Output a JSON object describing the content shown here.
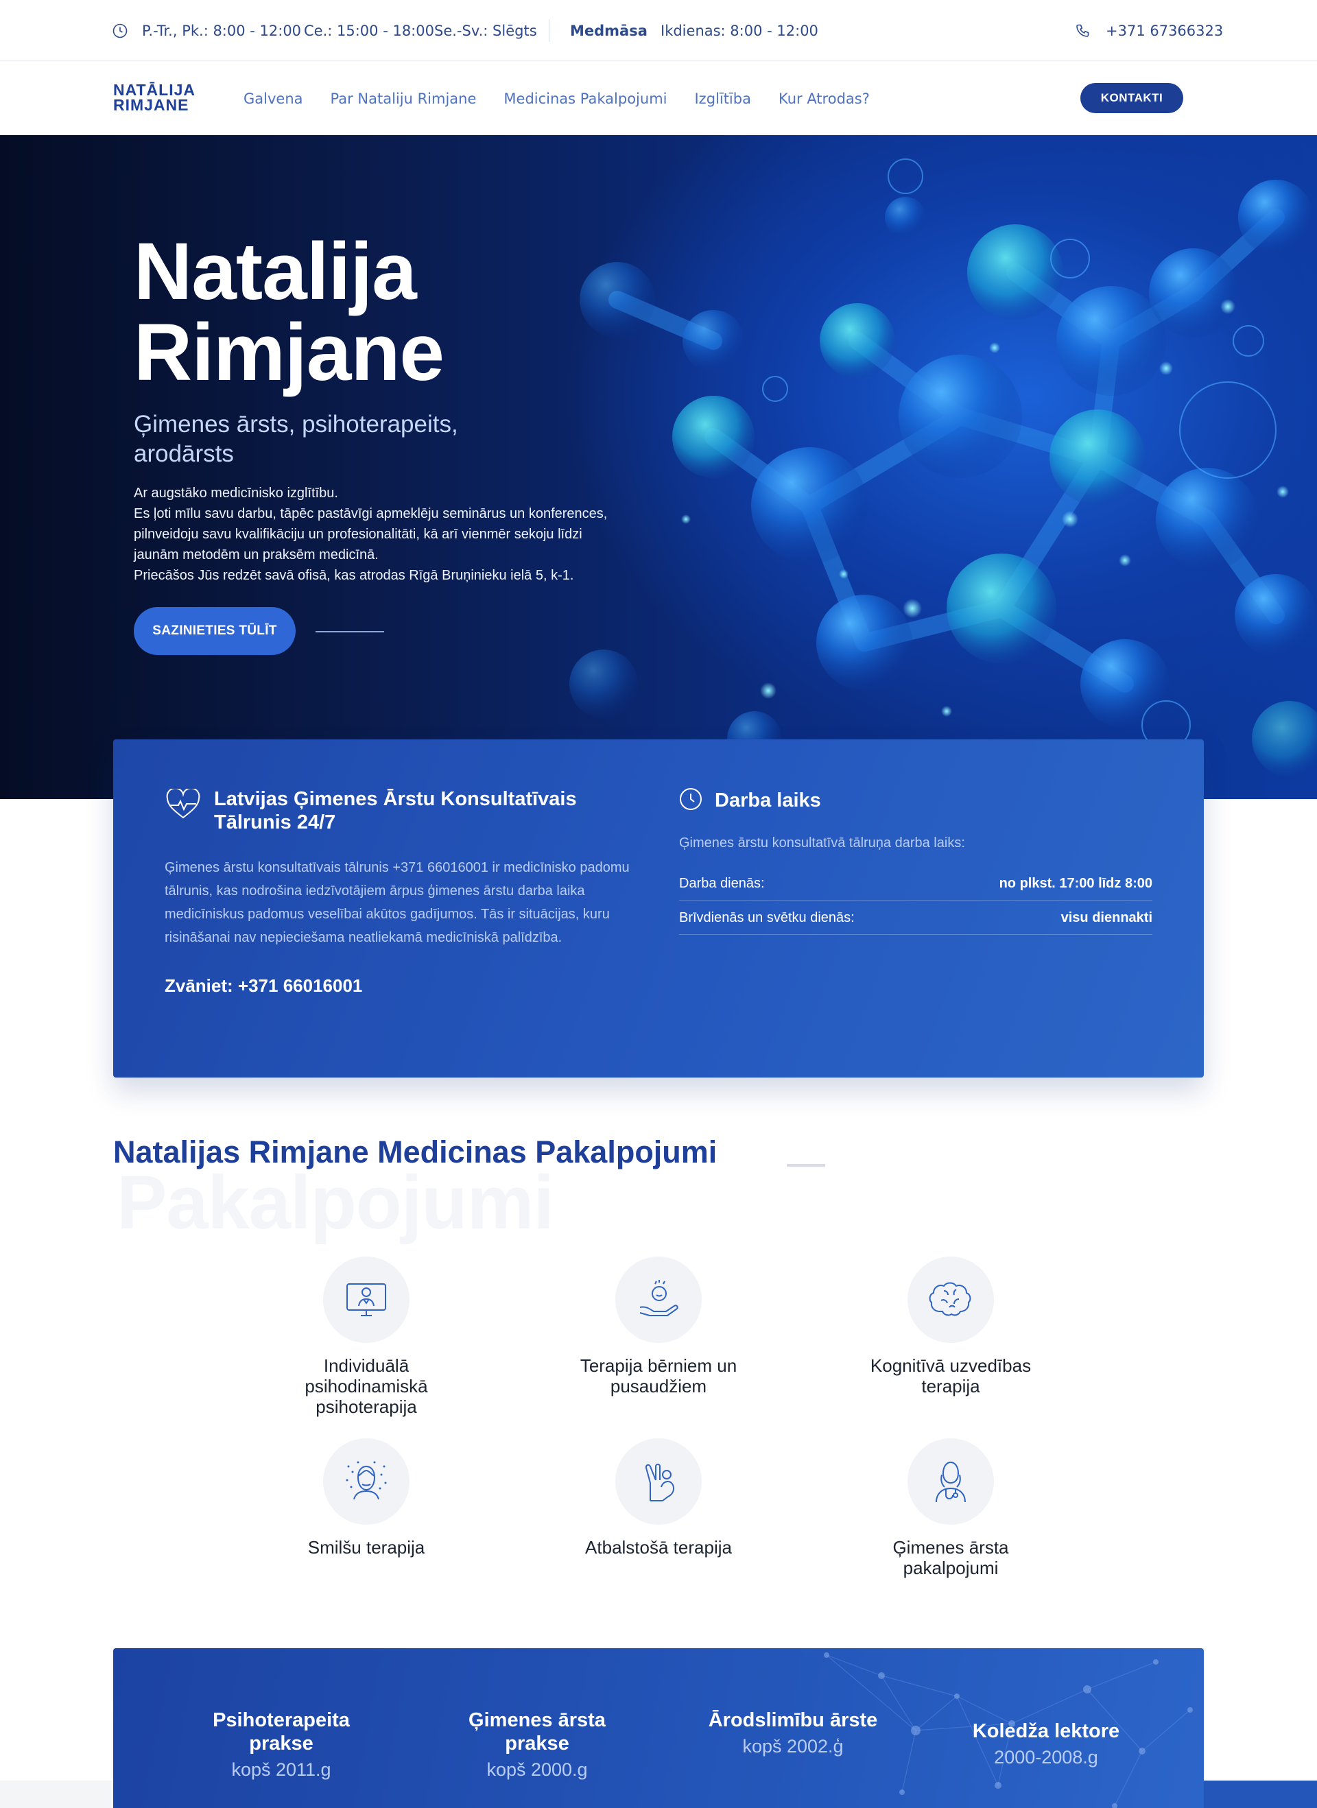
{
  "topbar": {
    "hours_weekdays": "P.-Tr., Pk.: 8:00 - 12:00",
    "hours_thursday": "Ce.: 15:00 - 18:00",
    "hours_weekend": "Se.-Sv.: Slēgts",
    "nurse_label": "Medmāsa",
    "nurse_hours": "Ikdienas: 8:00 - 12:00",
    "phone": "+371 67366323"
  },
  "nav": {
    "logo_line1": "NATĀLIJA",
    "logo_line2": "RIMJANE",
    "links": [
      "Galvena",
      "Par Nataliju Rimjane",
      "Medicinas Pakalpojumi",
      "Izglītība",
      "Kur Atrodas?"
    ],
    "cta": "KONTAKTI"
  },
  "hero": {
    "name_line1": "Natalija",
    "name_line2": "Rimjane",
    "subtitle": "Ģimenes ārsts, psihoterapeits, arodārsts",
    "text_lines": [
      "Ar augstāko medicīnisko izglītību.",
      "Es ļoti mīlu savu darbu, tāpēc pastāvīgi apmeklēju seminārus un konferences, pilnveidoju savu kvalifikāciju un profesionalitāti, kā arī vienmēr sekoju līdzi jaunām metodēm un praksēm medicīnā.",
      "Priecāšos Jūs redzēt savā ofisā, kas atrodas Rīgā Bruņinieku ielā 5, k-1."
    ],
    "cta": "SAZINIETIES TŪLĪT"
  },
  "info": {
    "left_title": "Latvijas Ģimenes Ārstu Konsultatīvais Tālrunis 24/7",
    "left_desc": "Ģimenes ārstu konsultatīvais tālrunis +371 66016001 ir medicīnisko padomu tālrunis, kas nodrošina iedzīvotājiem ārpus ģimenes ārstu darba laika medicīniskus padomus veselībai akūtos gadījumos. Tās ir situācijas, kuru risināšanai nav nepieciešama neatliekamā medicīniskā palīdzība.",
    "left_call": "Zvāniet: +371 66016001",
    "right_title": "Darba laiks",
    "right_desc": "Ģimenes ārstu konsultatīvā tālruņa darba laiks:",
    "rows": [
      {
        "label": "Darba dienās:",
        "value": "no plkst. 17:00 līdz 8:00"
      },
      {
        "label": "Brīvdienās un svētku dienās:",
        "value": "visu diennakti"
      }
    ]
  },
  "services": {
    "title": "Natalijas Rimjane Medicinas Pakalpojumi",
    "watermark": "Pakalpojumi",
    "items": [
      {
        "label": "Individuālā psihodinamiskā psihoterapija",
        "icon": "doctor-monitor-icon"
      },
      {
        "label": "Terapija bērniem un pusaudžiem",
        "icon": "child-hand-icon"
      },
      {
        "label": "Kognitīvā uzvedības terapija",
        "icon": "brain-icon"
      },
      {
        "label": "Smilšu terapija",
        "icon": "sand-face-icon"
      },
      {
        "label": "Atbalstošā terapija",
        "icon": "support-hands-icon"
      },
      {
        "label": "Ģimenes ārsta pakalpojumi",
        "icon": "family-doctor-icon"
      }
    ]
  },
  "stats": [
    {
      "title": "Psihoterapeita prakse",
      "since": "kopš 2011.g"
    },
    {
      "title": "Ģimenes ārsta prakse",
      "since": "kopš 2000.g"
    },
    {
      "title": "Ārodslimību ārste",
      "since": "kopš 2002.ģ"
    },
    {
      "title": "Koledža lektore",
      "since": "2000-2008.g"
    }
  ],
  "colors": {
    "brand_dark": "#1e3f9a",
    "brand_blue": "#2558be",
    "hero_bg": "#0b2c80"
  }
}
